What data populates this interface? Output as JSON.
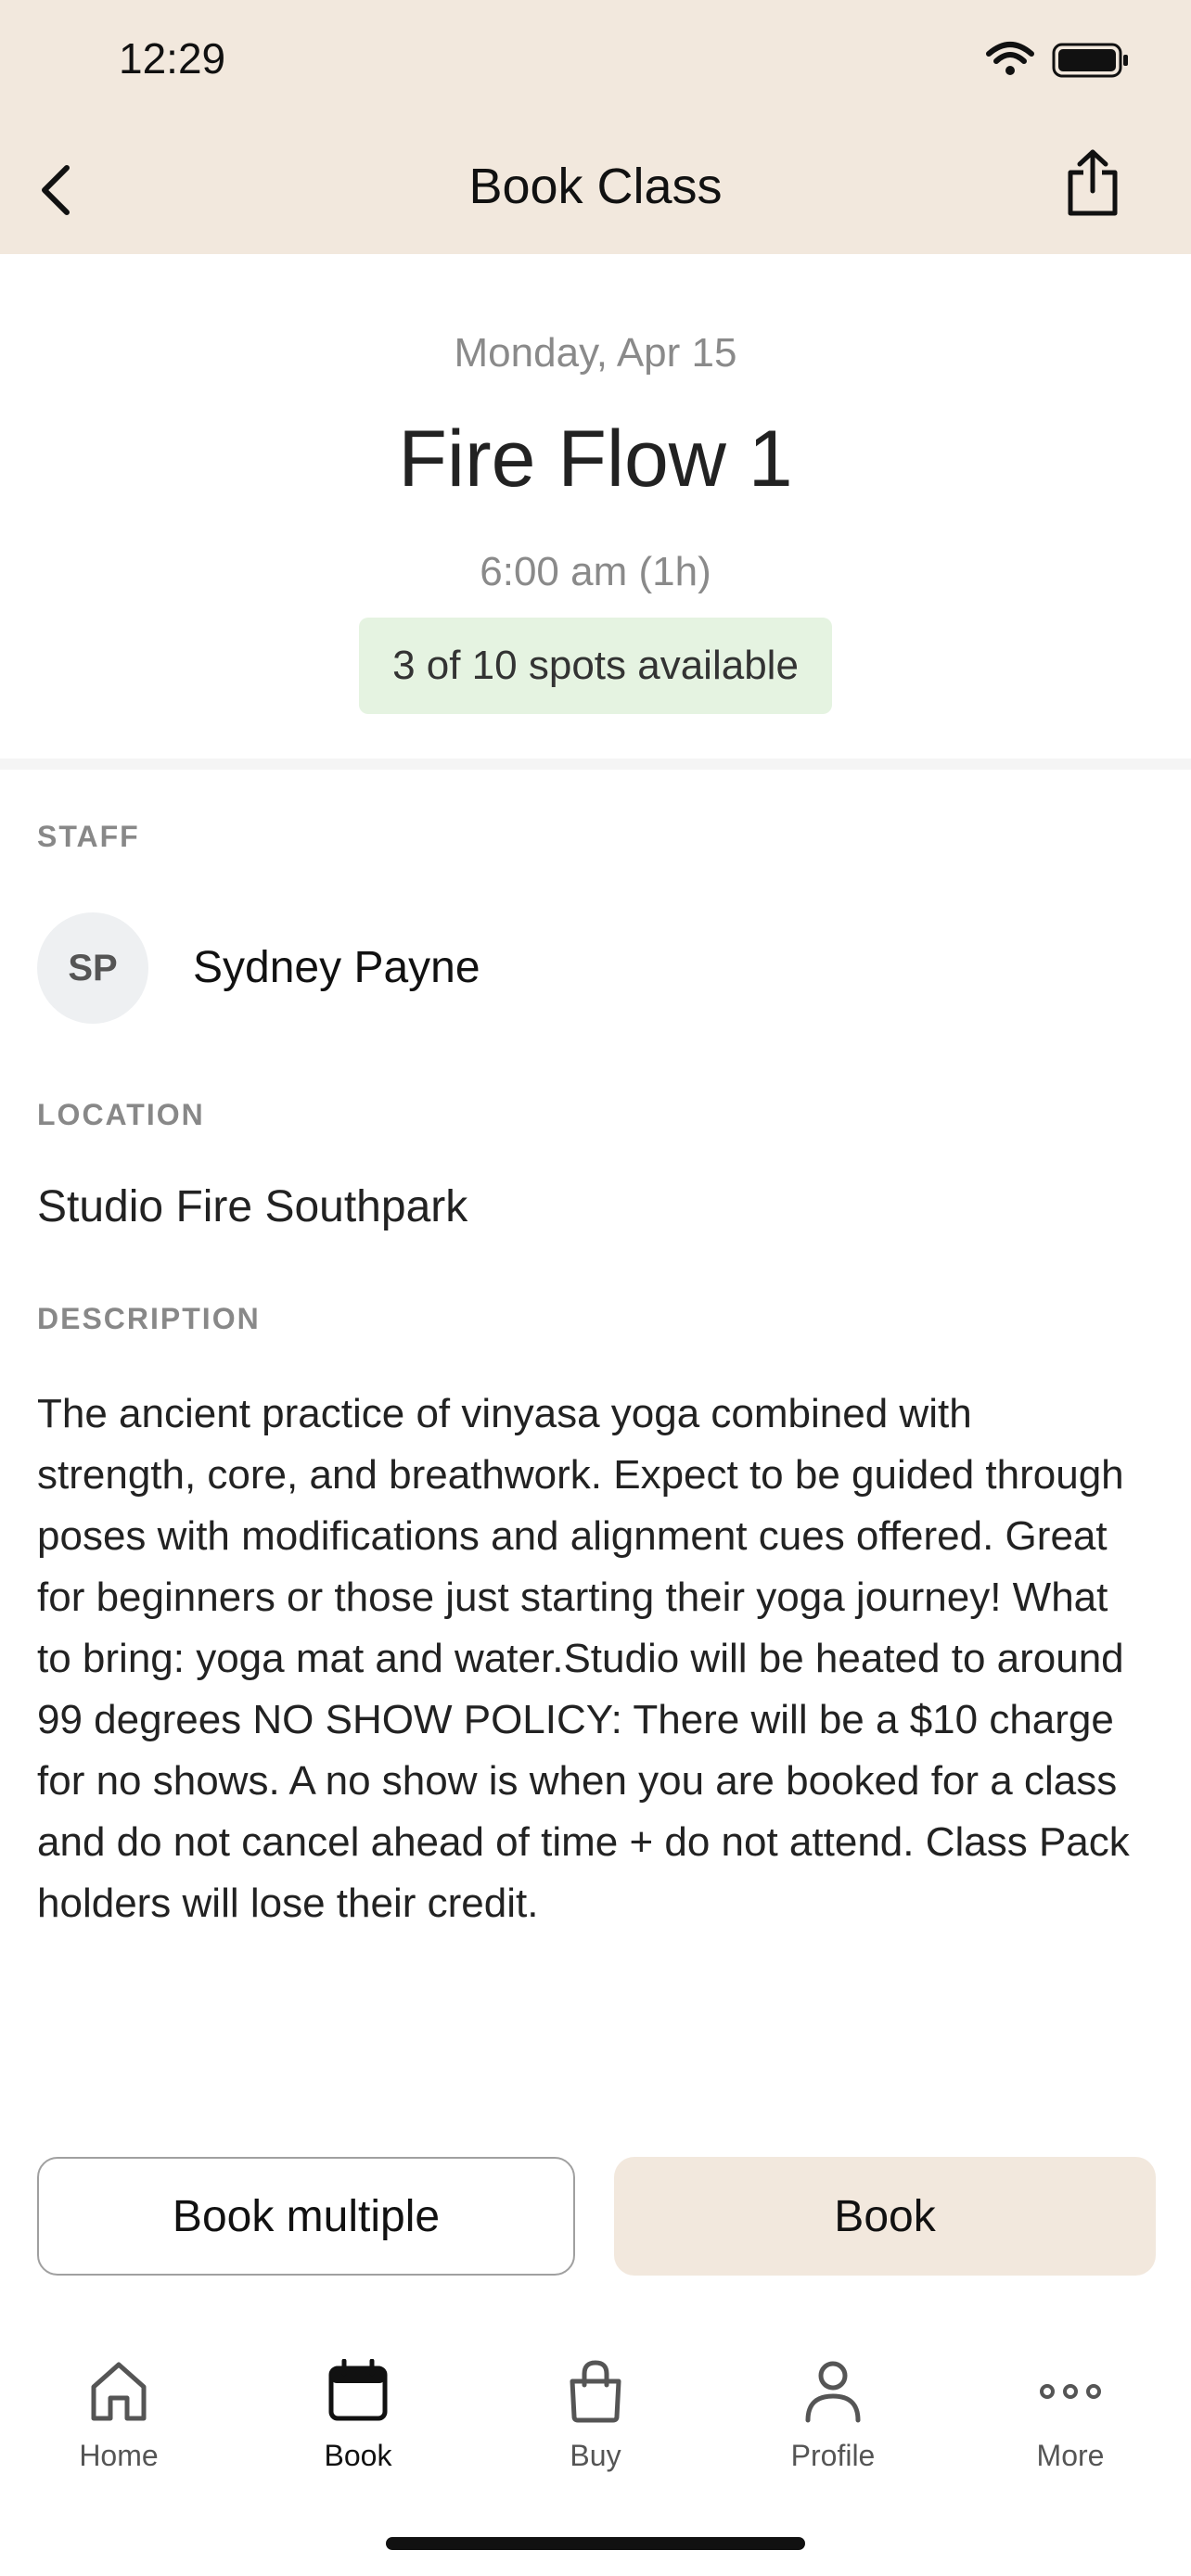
{
  "status_bar": {
    "time": "12:29"
  },
  "nav": {
    "title": "Book Class"
  },
  "class": {
    "date": "Monday, Apr 15",
    "title": "Fire Flow 1",
    "time": "6:00 am (1h)",
    "spots": "3 of 10 spots available"
  },
  "staff": {
    "label": "STAFF",
    "initials": "SP",
    "name": "Sydney Payne"
  },
  "location": {
    "label": "LOCATION",
    "name": "Studio Fire Southpark"
  },
  "description": {
    "label": "DESCRIPTION",
    "text": "The ancient practice of vinyasa yoga combined with strength, core, and breathwork. Expect to be guided through poses with modifications and alignment cues offered. Great for beginners or those just starting their yoga journey! What to bring: yoga mat and water.Studio will be heated to around 99 degrees NO SHOW POLICY: There will be a $10 charge for no shows. A no show is when you are booked for a class and do not cancel ahead of time + do not attend. Class Pack holders will lose their credit."
  },
  "actions": {
    "book_multiple": "Book multiple",
    "book": "Book"
  },
  "tabs": [
    {
      "label": "Home",
      "icon": "home-icon"
    },
    {
      "label": "Book",
      "icon": "calendar-icon"
    },
    {
      "label": "Buy",
      "icon": "shopping-bag-icon"
    },
    {
      "label": "Profile",
      "icon": "person-icon"
    },
    {
      "label": "More",
      "icon": "more-icon"
    }
  ],
  "colors": {
    "header_bg": "#f2e8dd",
    "spots_bg": "#e5f3e1",
    "book_bg": "#f2e8dd"
  }
}
